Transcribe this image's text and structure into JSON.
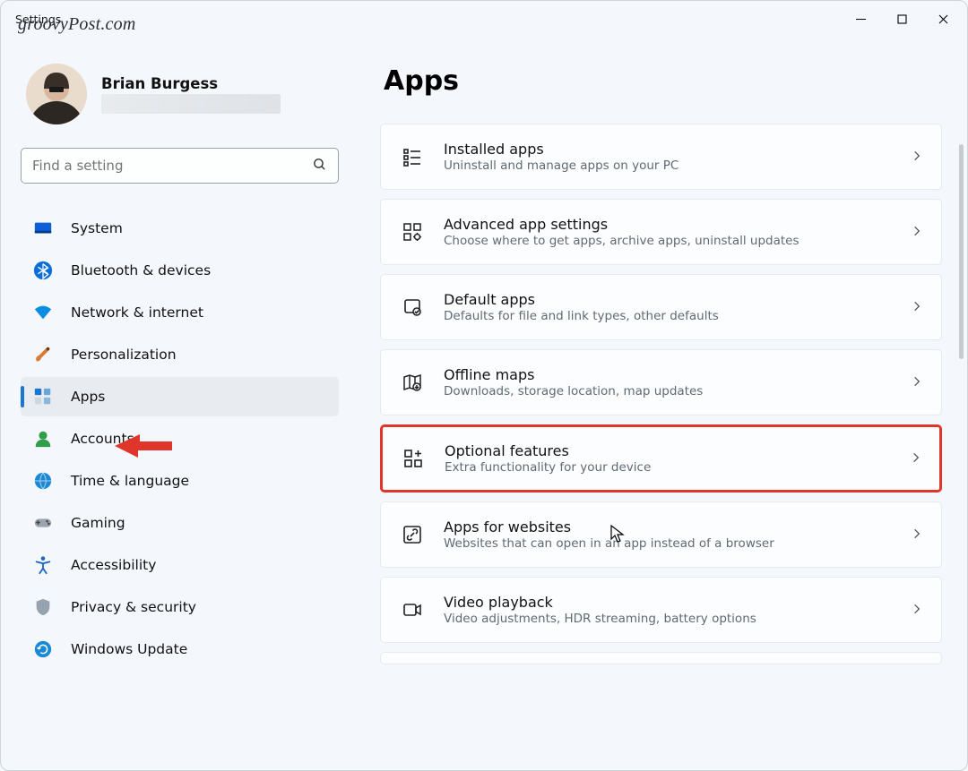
{
  "watermark": "groovyPost.com",
  "window": {
    "title": "Settings"
  },
  "profile": {
    "name": "Brian Burgess"
  },
  "search": {
    "placeholder": "Find a setting"
  },
  "sidebar": {
    "items": [
      {
        "label": "System",
        "icon": "system-icon"
      },
      {
        "label": "Bluetooth & devices",
        "icon": "bluetooth-icon"
      },
      {
        "label": "Network & internet",
        "icon": "wifi-icon"
      },
      {
        "label": "Personalization",
        "icon": "brush-icon"
      },
      {
        "label": "Apps",
        "icon": "apps-icon",
        "active": true
      },
      {
        "label": "Accounts",
        "icon": "person-icon"
      },
      {
        "label": "Time & language",
        "icon": "globe-icon"
      },
      {
        "label": "Gaming",
        "icon": "gamepad-icon"
      },
      {
        "label": "Accessibility",
        "icon": "accessibility-icon"
      },
      {
        "label": "Privacy & security",
        "icon": "shield-icon"
      },
      {
        "label": "Windows Update",
        "icon": "update-icon"
      }
    ]
  },
  "page": {
    "title": "Apps"
  },
  "cards": [
    {
      "title": "Installed apps",
      "sub": "Uninstall and manage apps on your PC",
      "icon": "list-icon"
    },
    {
      "title": "Advanced app settings",
      "sub": "Choose where to get apps, archive apps, uninstall updates",
      "icon": "grid-gear-icon"
    },
    {
      "title": "Default apps",
      "sub": "Defaults for file and link types, other defaults",
      "icon": "default-icon"
    },
    {
      "title": "Offline maps",
      "sub": "Downloads, storage location, map updates",
      "icon": "map-icon"
    },
    {
      "title": "Optional features",
      "sub": "Extra functionality for your device",
      "icon": "grid-plus-icon",
      "hl": true
    },
    {
      "title": "Apps for websites",
      "sub": "Websites that can open in an app instead of a browser",
      "icon": "link-icon"
    },
    {
      "title": "Video playback",
      "sub": "Video adjustments, HDR streaming, battery options",
      "icon": "video-icon"
    }
  ]
}
